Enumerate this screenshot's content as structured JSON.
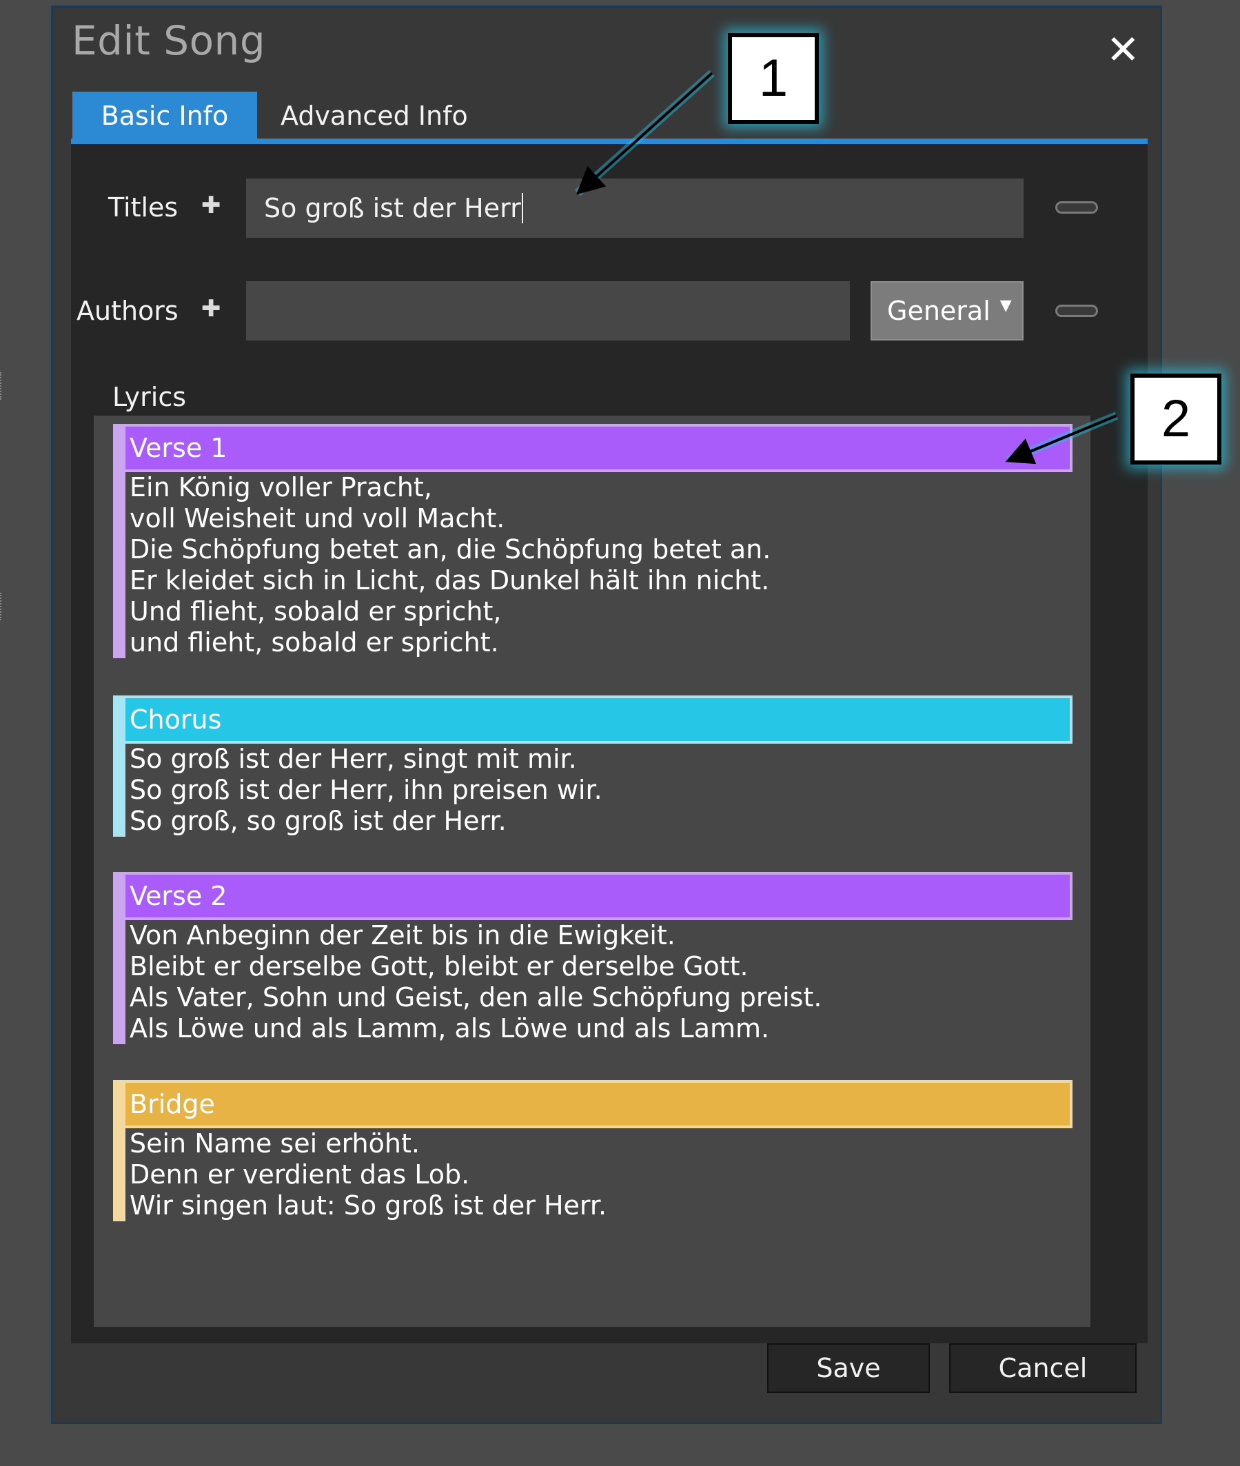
{
  "dialog": {
    "title": "Edit Song",
    "close_glyph": "✕"
  },
  "tabs": [
    {
      "label": "Basic Info",
      "active": true
    },
    {
      "label": "Advanced Info",
      "active": false
    }
  ],
  "fields": {
    "titles_label": "Titles",
    "titles_value": "So groß ist der Herr",
    "authors_label": "Authors",
    "authors_value": "",
    "author_type": "General",
    "add_icon": "plus-icon",
    "remove_icon": "minus-icon"
  },
  "lyrics": {
    "label": "Lyrics",
    "sections": [
      {
        "name": "Verse 1",
        "kind": "verse",
        "color": "#a95cf9",
        "lines": [
          "Ein König voller Pracht,",
          "voll Weisheit und voll Macht.",
          "Die Schöpfung betet an, die Schöpfung betet an.",
          "Er kleidet sich in Licht, das Dunkel hält ihn nicht.",
          "Und flieht, sobald er spricht,",
          "und flieht, sobald er spricht."
        ]
      },
      {
        "name": "Chorus",
        "kind": "chorus",
        "color": "#26c6e6",
        "lines": [
          "So groß ist der Herr, singt mit mir.",
          "So groß ist der Herr, ihn preisen wir.",
          "So groß, so groß ist der Herr."
        ]
      },
      {
        "name": "Verse 2",
        "kind": "verse",
        "color": "#a95cf9",
        "lines": [
          "Von Anbeginn der Zeit bis in die Ewigkeit.",
          "Bleibt er derselbe Gott, bleibt er derselbe Gott.",
          "Als Vater, Sohn und Geist, den alle Schöpfung preist.",
          "Als Löwe und als Lamm, als Löwe und als Lamm."
        ]
      },
      {
        "name": "Bridge",
        "kind": "bridge",
        "color": "#e8b345",
        "lines": [
          "Sein Name sei erhöht.",
          "Denn er verdient das Lob.",
          "Wir singen laut: So groß ist der Herr."
        ]
      }
    ]
  },
  "buttons": {
    "save": "Save",
    "cancel": "Cancel"
  },
  "callouts": [
    "1",
    "2"
  ],
  "colors": {
    "accent": "#2c8ad4",
    "callout_glow": "#26c6e6"
  }
}
